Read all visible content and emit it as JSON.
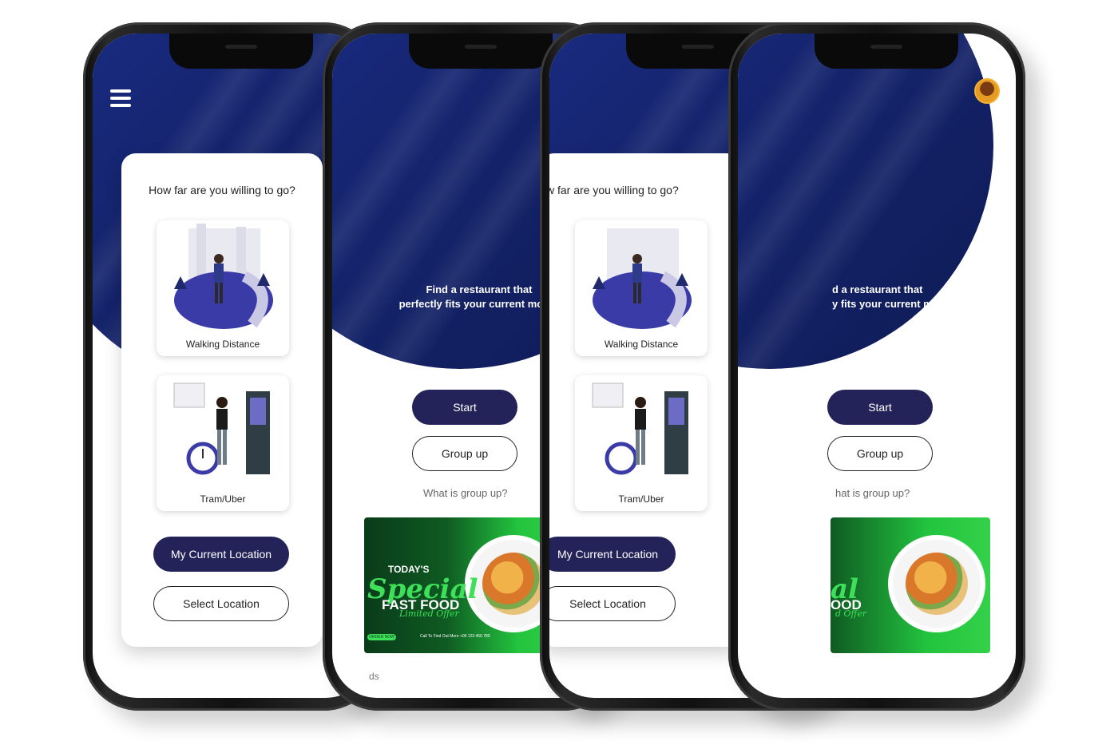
{
  "screens": {
    "distance": {
      "question": "How far are you willing to go?",
      "question_clipped": "w far are you willing to go?",
      "options": [
        {
          "label": "Walking Distance"
        },
        {
          "label": "Tram/Uber"
        }
      ],
      "current_location": "My Current Location",
      "select_location": "Select Location"
    },
    "home": {
      "tagline_line1": "Find a restaurant that",
      "tagline_line2": "perfectly fits your current mood!",
      "tagline_clipped_line1": "d a restaurant that",
      "tagline_clipped_line2": "y fits your current mood!",
      "start": "Start",
      "group_up": "Group up",
      "hint": "What is group up?",
      "hint_clipped": "hat is group up?",
      "footer_text": "ds",
      "banner": {
        "line1": "TODAY'S",
        "line2": "Special",
        "line3": "FAST FOOD",
        "line4": "Limited Offer",
        "line2_clipped": "al",
        "line3_clipped": "OOD",
        "line4_clipped": "d Offer",
        "order": "ORDER NOW",
        "call": "Call To Find Out More\n+00 123 456 789"
      }
    }
  },
  "colors": {
    "hero_blue": "#15246e",
    "button_navy": "#23235a",
    "banner_green": "#22c33e"
  }
}
